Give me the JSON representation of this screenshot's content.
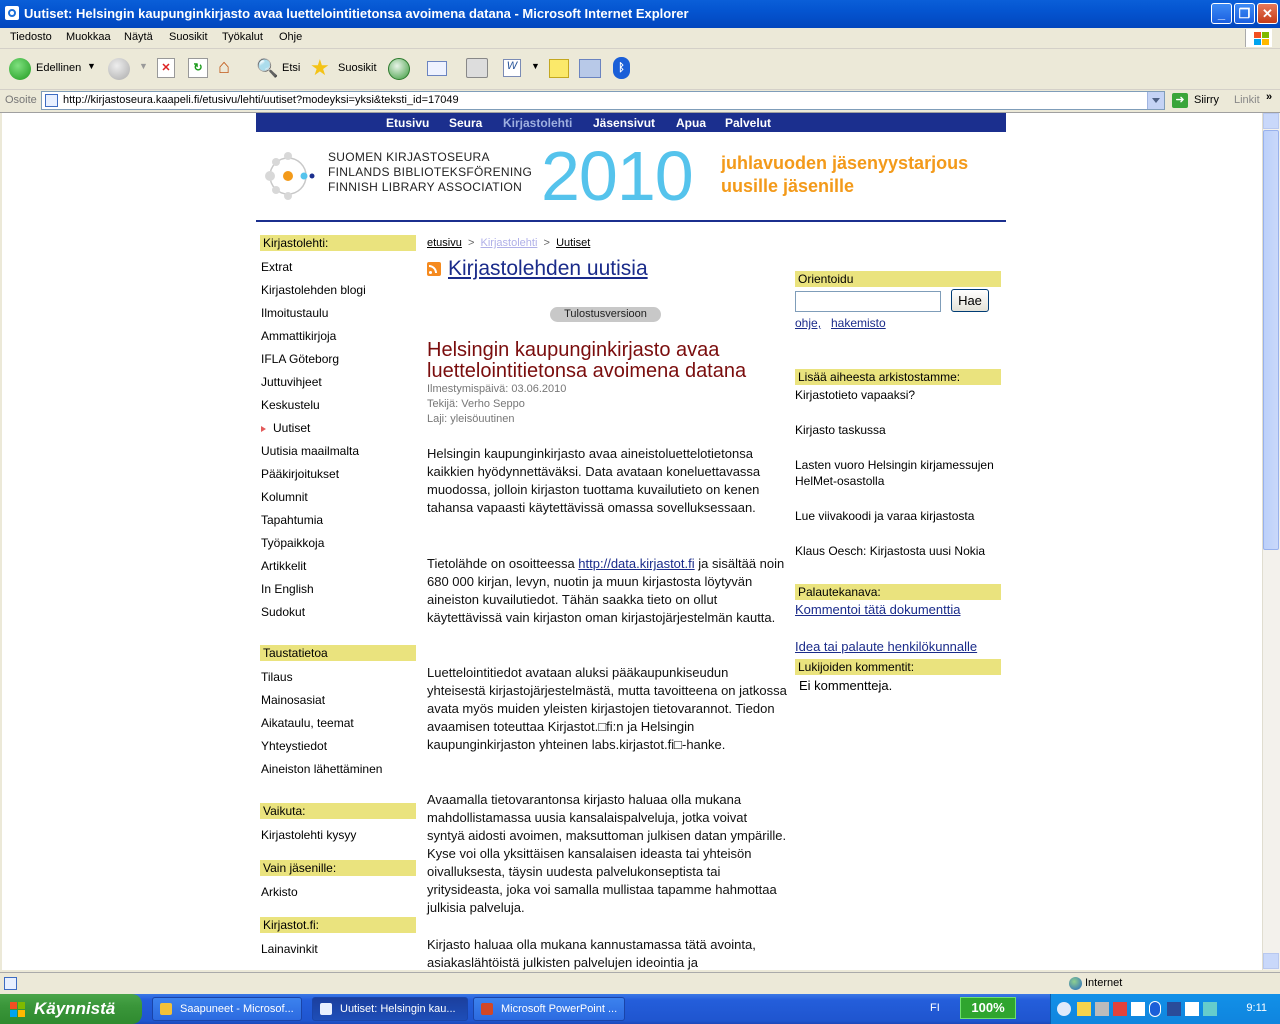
{
  "window": {
    "title": "Uutiset: Helsingin kaupunginkirjasto avaa luettelointitietonsa avoimena datana - Microsoft Internet Explorer"
  },
  "menu": [
    "Tiedosto",
    "Muokkaa",
    "Näytä",
    "Suosikit",
    "Työkalut",
    "Ohje"
  ],
  "toolbar": {
    "back": "Edellinen",
    "search": "Etsi",
    "favorites": "Suosikit"
  },
  "address": {
    "label": "Osoite",
    "url": "http://kirjastoseura.kaapeli.fi/etusivu/lehti/uutiset?modeyksi=yksi&teksti_id=17049",
    "go": "Siirry",
    "links": "Linkit"
  },
  "site": {
    "nav": [
      "Etusivu",
      "Seura",
      "Kirjastolehti",
      "Jäsensivut",
      "Apua",
      "Palvelut"
    ],
    "org_lines": [
      "SUOMEN KIRJASTOSEURA",
      "FINLANDS BIBLIOTEKSFÖRENING",
      "FINNISH LIBRARY ASSOCIATION"
    ],
    "year": "2010",
    "offer_lines": [
      "juhlavuoden jäsenyystarjous",
      "uusille jäsenille"
    ]
  },
  "sidebar": {
    "kirjastolehti_hd": "Kirjastolehti:",
    "kirjastolehti": [
      "Extrat",
      "Kirjastolehden blogi",
      "Ilmoitustaulu",
      "Ammattikirjoja",
      "IFLA Göteborg",
      "Juttuvihjeet",
      "Keskustelu",
      "Uutiset",
      "Uutisia maailmalta",
      "Pääkirjoitukset",
      "Kolumnit",
      "Tapahtumia",
      "Työpaikkoja",
      "Artikkelit",
      "In English",
      "Sudokut"
    ],
    "taustatietoa_hd": "Taustatietoa",
    "taustatietoa": [
      "Tilaus",
      "Mainosasiat",
      "Aikataulu, teemat",
      "Yhteystiedot",
      "Aineiston lähettäminen"
    ],
    "vaikuta_hd": "Vaikuta:",
    "vaikuta": [
      "Kirjastolehti kysyy"
    ],
    "vain_hd": "Vain jäsenille:",
    "vain": [
      "Arkisto"
    ],
    "kirjastot_hd": "Kirjastot.fi:",
    "kirjastot": [
      "Lainavinkit"
    ]
  },
  "breadcrumb": {
    "home": "etusivu",
    "section": "Kirjastolehti",
    "current": "Uutiset"
  },
  "main": {
    "page_title": "Kirjastolehden uutisia",
    "print_label": "Tulostusversioon",
    "article_title": "Helsingin kaupunginkirjasto avaa luettelointitietonsa avoimena datana",
    "date": "Ilmestymispäivä: 03.06.2010",
    "author": "Tekijä: Verho Seppo",
    "type": "Laji: yleisöuutinen",
    "p1": "Helsingin kaupunginkirjasto avaa aineistoluettelotietonsa kaikkien hyödynnettäväksi. Data avataan koneluettavassa muodossa, jolloin kirjaston tuottama kuvailutieto on kenen tahansa vapaasti käytettävissä omassa sovelluksessaan.",
    "p2_pre": "Tietolähde on osoitteessa ",
    "p2_link": "http://data.kirjastot.fi",
    "p2_post": " ja sisältää noin 680 000 kirjan, levyn, nuotin ja muun kirjastosta löytyvän aineiston kuvailutiedot. Tähän saakka tieto on ollut käytettävissä vain kirjaston oman kirjastojärjestelmän kautta.",
    "p3": "Luettelointitiedot avataan aluksi pääkaupunkiseudun yhteisestä kirjastojärjestelmästä, mutta tavoitteena on jatkossa avata myös muiden yleisten kirjastojen tietovarannot. Tiedon avaamisen toteuttaa Kirjastot.□fi:n ja Helsingin kaupunginkirjaston yhteinen labs.kirjastot.fi□-hanke.",
    "p4": "Avaamalla tietovarantonsa kirjasto haluaa olla mukana mahdollistamassa uusia kansalaispalveluja, jotka voivat syntyä aidosti avoimen, maksuttoman julkisen datan ympärille. Kyse voi olla yksittäisen kansalaisen ideasta tai yhteisön oivalluksesta, täysin uudesta palvelukonseptista tai yritysideasta, joka voi samalla mullistaa tapamme hahmottaa julkisia palveluja.",
    "p5": "Kirjasto haluaa olla mukana kannustamassa tätä avointa, asiakaslähtöistä julkisten palvelujen ideointia ja"
  },
  "right": {
    "orientoidu_hd": "Orientoidu",
    "search_button": "Hae",
    "help": "ohje,",
    "index": "hakemisto",
    "archive_hd": "Lisää aiheesta arkistostamme:",
    "archive": [
      "Kirjastotieto vapaaksi?",
      "Kirjasto taskussa",
      "Lasten vuoro Helsingin kirjamessujen HelMet-osastolla",
      "Lue viivakoodi ja varaa kirjastosta",
      "Klaus Oesch: Kirjastosta uusi Nokia"
    ],
    "feedback_hd": "Palautekanava:",
    "comment_link": "Kommentoi tätä dokumenttia",
    "idea_link": "Idea tai palaute henkilökunnalle",
    "comments_hd": "Lukijoiden kommentit:",
    "no_comments": "Ei kommentteja."
  },
  "status": {
    "zone": "Internet"
  },
  "taskbar": {
    "start": "Käynnistä",
    "tasks": [
      "Saapuneet - Microsof...",
      "Uutiset: Helsingin kau...",
      "Microsoft PowerPoint ..."
    ],
    "lang": "FI",
    "zoom": "100%",
    "clock": "9:11"
  }
}
